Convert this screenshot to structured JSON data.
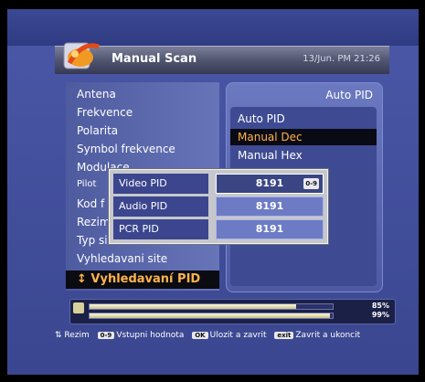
{
  "header": {
    "title": "Manual Scan",
    "datetime": "13/Jun. PM 21:26"
  },
  "menu": {
    "items": [
      "Antena",
      "Frekvence",
      "Polarita",
      "Symbol frekvence",
      "Modulace",
      "Pilot",
      "Kod f",
      "Rezim",
      "Typ site",
      "Vyhledavani site"
    ],
    "selected": "↕ Vyhledavaní PID"
  },
  "pid_panel": {
    "title": "Auto PID",
    "options": [
      "Auto PID",
      "Manual Dec",
      "Manual Hex"
    ],
    "selected": "Manual Dec"
  },
  "pid_popup": {
    "rows": [
      {
        "label": "Video PID",
        "value": "8191",
        "badge": "0-9"
      },
      {
        "label": "Audio PID",
        "value": "8191"
      },
      {
        "label": "PCR PID",
        "value": "8191"
      }
    ]
  },
  "signal": {
    "strength_text": "85%",
    "quality_text": "99%",
    "strength": 0.85,
    "quality": 0.99
  },
  "help": [
    {
      "key": "",
      "label": "⇅ Rezim"
    },
    {
      "key": "0-9",
      "label": "Vstupni hodnota"
    },
    {
      "key": "OK",
      "label": "Ulozit a zavrit"
    },
    {
      "key": "exit",
      "label": "Zavrit a ukoncit"
    }
  ],
  "colors": {
    "highlight_text": "#ffb44b",
    "panel": "#4e5aa1"
  }
}
